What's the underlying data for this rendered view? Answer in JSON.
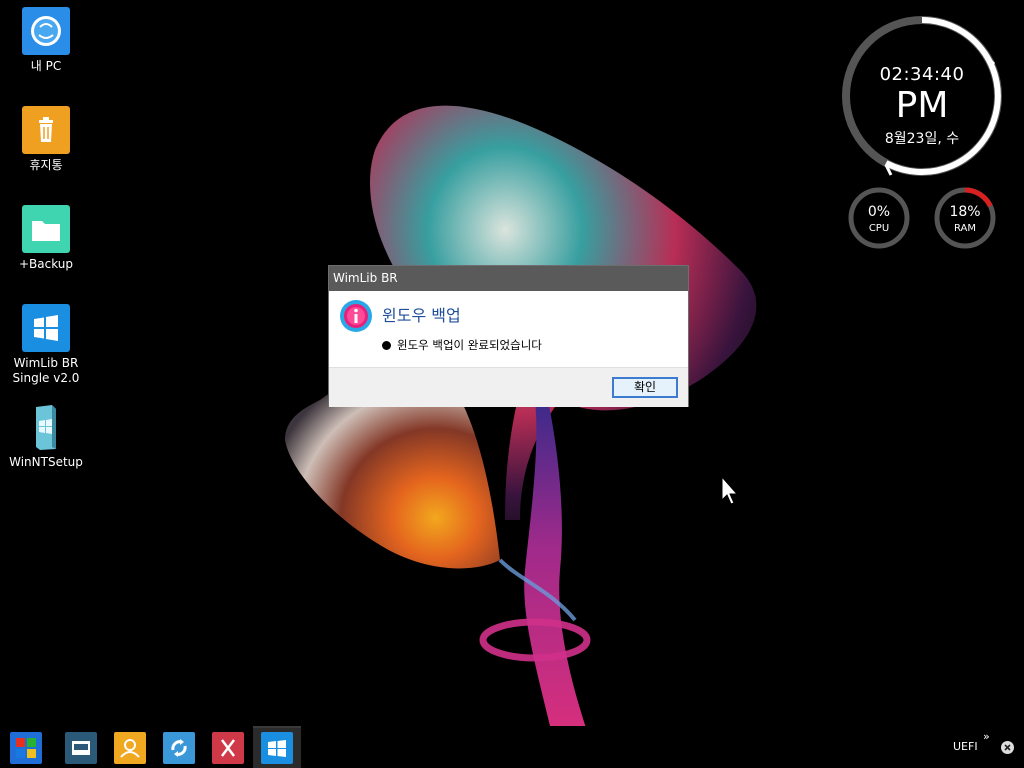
{
  "desktop_icons": [
    {
      "label": "내 PC",
      "icon": "finder-face-icon",
      "color": "#2a8ee8"
    },
    {
      "label": "휴지통",
      "icon": "trash-icon",
      "color": "#f0a020"
    },
    {
      "label": "+Backup",
      "icon": "folder-icon",
      "color": "#3fd5b0"
    },
    {
      "label": "WimLib BR\nSingle v2.0",
      "icon": "windows-logo-icon",
      "color": "#1a8ee0"
    },
    {
      "label": "WinNTSetup",
      "icon": "setup-book-icon",
      "color": "#5ab0c8"
    }
  ],
  "clock": {
    "time": "02:34:40",
    "ampm": "PM",
    "date": "8월23일, 수"
  },
  "meters": {
    "cpu": {
      "value": "0%",
      "label": "CPU",
      "level": 0
    },
    "ram": {
      "value": "18%",
      "label": "RAM",
      "level": 0.18
    }
  },
  "dialog": {
    "title": "WimLib BR",
    "heading": "윈도우 백업",
    "message": "윈도우 백업이 완료되었습니다",
    "ok_label": "확인",
    "icon": "info-icon"
  },
  "taskbar": {
    "buttons": [
      {
        "name": "start-button",
        "icon": "start-tiles-icon"
      },
      {
        "name": "taskbar-app-console",
        "icon": "console-window-icon"
      },
      {
        "name": "taskbar-app-user",
        "icon": "user-icon"
      },
      {
        "name": "taskbar-app-refresh",
        "icon": "refresh-icon"
      },
      {
        "name": "taskbar-app-x",
        "icon": "x-app-icon"
      },
      {
        "name": "taskbar-app-wimlib",
        "icon": "windows-logo-icon"
      }
    ],
    "tray_label": "UEFI",
    "tray_chevron": "»"
  },
  "colors": {
    "dialog_heading": "#1f4e9c",
    "dialog_titlebar": "#5a5a5a",
    "ok_button_border": "#3d7bd1",
    "ram_meter_accent": "#d92020"
  }
}
